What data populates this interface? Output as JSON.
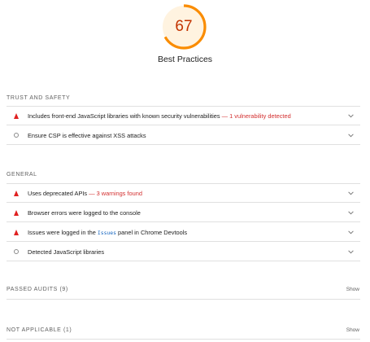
{
  "score": {
    "value": "67",
    "fraction": 0.67,
    "title": "Best Practices",
    "color": "#fa8c00",
    "text_color": "#c33300",
    "track_color": "#fff3e0"
  },
  "groups": {
    "trust": {
      "title": "Trust and Safety",
      "audits": [
        {
          "label": "Includes front-end JavaScript libraries with known security vulnerabilities",
          "separator": " — ",
          "warning": "1 vulnerability detected",
          "status": "fail"
        },
        {
          "label": "Ensure CSP is effective against XSS attacks",
          "status": "info"
        }
      ]
    },
    "general": {
      "title": "General",
      "audits": [
        {
          "label": "Uses deprecated APIs",
          "separator": " — ",
          "warning": "3 warnings found",
          "status": "fail"
        },
        {
          "label": "Browser errors were logged to the console",
          "status": "fail"
        },
        {
          "label_before": "Issues were logged in the ",
          "code": "Issues",
          "label_after": " panel in Chrome Devtools",
          "status": "fail"
        },
        {
          "label": "Detected JavaScript libraries",
          "status": "info"
        }
      ]
    }
  },
  "clumps": {
    "passed": {
      "label": "PASSED AUDITS",
      "count": "(9)",
      "action": "Show"
    },
    "not_applicable": {
      "label": "NOT APPLICABLE",
      "count": "(1)",
      "action": "Show"
    }
  },
  "icons": {
    "fail": "red-triangle-icon",
    "info": "gray-circle-icon",
    "expand": "chevron-down-icon"
  }
}
